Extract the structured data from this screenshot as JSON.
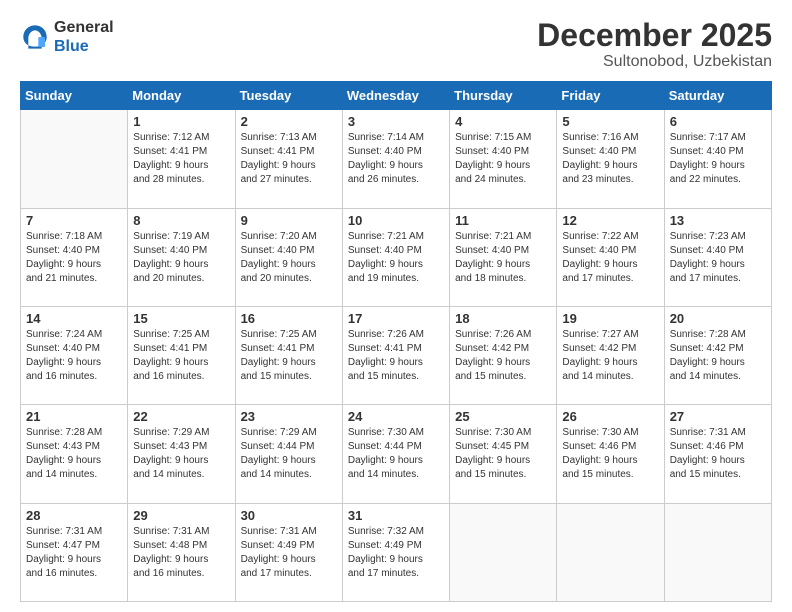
{
  "header": {
    "logo_general": "General",
    "logo_blue": "Blue",
    "month_year": "December 2025",
    "location": "Sultonobod, Uzbekistan"
  },
  "days_of_week": [
    "Sunday",
    "Monday",
    "Tuesday",
    "Wednesday",
    "Thursday",
    "Friday",
    "Saturday"
  ],
  "weeks": [
    [
      {
        "day": "",
        "info": ""
      },
      {
        "day": "1",
        "info": "Sunrise: 7:12 AM\nSunset: 4:41 PM\nDaylight: 9 hours\nand 28 minutes."
      },
      {
        "day": "2",
        "info": "Sunrise: 7:13 AM\nSunset: 4:41 PM\nDaylight: 9 hours\nand 27 minutes."
      },
      {
        "day": "3",
        "info": "Sunrise: 7:14 AM\nSunset: 4:40 PM\nDaylight: 9 hours\nand 26 minutes."
      },
      {
        "day": "4",
        "info": "Sunrise: 7:15 AM\nSunset: 4:40 PM\nDaylight: 9 hours\nand 24 minutes."
      },
      {
        "day": "5",
        "info": "Sunrise: 7:16 AM\nSunset: 4:40 PM\nDaylight: 9 hours\nand 23 minutes."
      },
      {
        "day": "6",
        "info": "Sunrise: 7:17 AM\nSunset: 4:40 PM\nDaylight: 9 hours\nand 22 minutes."
      }
    ],
    [
      {
        "day": "7",
        "info": "Sunrise: 7:18 AM\nSunset: 4:40 PM\nDaylight: 9 hours\nand 21 minutes."
      },
      {
        "day": "8",
        "info": "Sunrise: 7:19 AM\nSunset: 4:40 PM\nDaylight: 9 hours\nand 20 minutes."
      },
      {
        "day": "9",
        "info": "Sunrise: 7:20 AM\nSunset: 4:40 PM\nDaylight: 9 hours\nand 20 minutes."
      },
      {
        "day": "10",
        "info": "Sunrise: 7:21 AM\nSunset: 4:40 PM\nDaylight: 9 hours\nand 19 minutes."
      },
      {
        "day": "11",
        "info": "Sunrise: 7:21 AM\nSunset: 4:40 PM\nDaylight: 9 hours\nand 18 minutes."
      },
      {
        "day": "12",
        "info": "Sunrise: 7:22 AM\nSunset: 4:40 PM\nDaylight: 9 hours\nand 17 minutes."
      },
      {
        "day": "13",
        "info": "Sunrise: 7:23 AM\nSunset: 4:40 PM\nDaylight: 9 hours\nand 17 minutes."
      }
    ],
    [
      {
        "day": "14",
        "info": "Sunrise: 7:24 AM\nSunset: 4:40 PM\nDaylight: 9 hours\nand 16 minutes."
      },
      {
        "day": "15",
        "info": "Sunrise: 7:25 AM\nSunset: 4:41 PM\nDaylight: 9 hours\nand 16 minutes."
      },
      {
        "day": "16",
        "info": "Sunrise: 7:25 AM\nSunset: 4:41 PM\nDaylight: 9 hours\nand 15 minutes."
      },
      {
        "day": "17",
        "info": "Sunrise: 7:26 AM\nSunset: 4:41 PM\nDaylight: 9 hours\nand 15 minutes."
      },
      {
        "day": "18",
        "info": "Sunrise: 7:26 AM\nSunset: 4:42 PM\nDaylight: 9 hours\nand 15 minutes."
      },
      {
        "day": "19",
        "info": "Sunrise: 7:27 AM\nSunset: 4:42 PM\nDaylight: 9 hours\nand 14 minutes."
      },
      {
        "day": "20",
        "info": "Sunrise: 7:28 AM\nSunset: 4:42 PM\nDaylight: 9 hours\nand 14 minutes."
      }
    ],
    [
      {
        "day": "21",
        "info": "Sunrise: 7:28 AM\nSunset: 4:43 PM\nDaylight: 9 hours\nand 14 minutes."
      },
      {
        "day": "22",
        "info": "Sunrise: 7:29 AM\nSunset: 4:43 PM\nDaylight: 9 hours\nand 14 minutes."
      },
      {
        "day": "23",
        "info": "Sunrise: 7:29 AM\nSunset: 4:44 PM\nDaylight: 9 hours\nand 14 minutes."
      },
      {
        "day": "24",
        "info": "Sunrise: 7:30 AM\nSunset: 4:44 PM\nDaylight: 9 hours\nand 14 minutes."
      },
      {
        "day": "25",
        "info": "Sunrise: 7:30 AM\nSunset: 4:45 PM\nDaylight: 9 hours\nand 15 minutes."
      },
      {
        "day": "26",
        "info": "Sunrise: 7:30 AM\nSunset: 4:46 PM\nDaylight: 9 hours\nand 15 minutes."
      },
      {
        "day": "27",
        "info": "Sunrise: 7:31 AM\nSunset: 4:46 PM\nDaylight: 9 hours\nand 15 minutes."
      }
    ],
    [
      {
        "day": "28",
        "info": "Sunrise: 7:31 AM\nSunset: 4:47 PM\nDaylight: 9 hours\nand 16 minutes."
      },
      {
        "day": "29",
        "info": "Sunrise: 7:31 AM\nSunset: 4:48 PM\nDaylight: 9 hours\nand 16 minutes."
      },
      {
        "day": "30",
        "info": "Sunrise: 7:31 AM\nSunset: 4:49 PM\nDaylight: 9 hours\nand 17 minutes."
      },
      {
        "day": "31",
        "info": "Sunrise: 7:32 AM\nSunset: 4:49 PM\nDaylight: 9 hours\nand 17 minutes."
      },
      {
        "day": "",
        "info": ""
      },
      {
        "day": "",
        "info": ""
      },
      {
        "day": "",
        "info": ""
      }
    ]
  ]
}
